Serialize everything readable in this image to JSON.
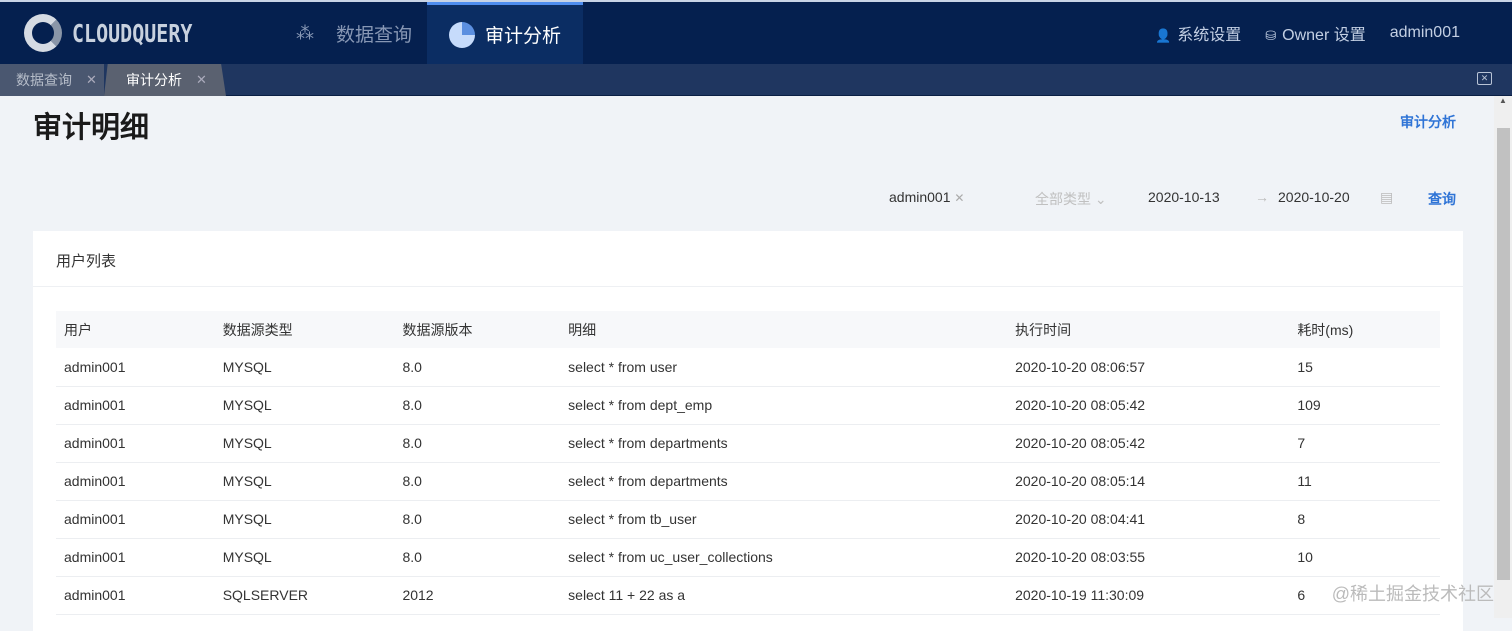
{
  "app": {
    "logo": "CLOUDQUERY",
    "nav": [
      {
        "label": "数据查询",
        "icon": "nodes-icon"
      },
      {
        "label": "审计分析",
        "icon": "pie-chart-icon",
        "active": true
      }
    ],
    "right": {
      "system_settings": "系统设置",
      "owner_settings": "Owner 设置",
      "user": "admin001"
    }
  },
  "tabs": [
    {
      "label": "数据查询"
    },
    {
      "label": "审计分析",
      "active": true
    }
  ],
  "page": {
    "title": "审计明细",
    "link": "审计分析"
  },
  "filters": {
    "user": "admin001",
    "type_placeholder": "全部类型",
    "start": "2020-10-13",
    "arrow": "→",
    "end": "2020-10-20",
    "query": "查询"
  },
  "card": {
    "title": "用户列表",
    "columns": [
      "用户",
      "数据源类型",
      "数据源版本",
      "明细",
      "执行时间",
      "耗时(ms)"
    ],
    "rows": [
      [
        "admin001",
        "MYSQL",
        "8.0",
        "select * from user",
        "2020-10-20 08:06:57",
        "15"
      ],
      [
        "admin001",
        "MYSQL",
        "8.0",
        "select * from dept_emp",
        "2020-10-20 08:05:42",
        "109"
      ],
      [
        "admin001",
        "MYSQL",
        "8.0",
        "select * from departments",
        "2020-10-20 08:05:42",
        "7"
      ],
      [
        "admin001",
        "MYSQL",
        "8.0",
        "select * from departments",
        "2020-10-20 08:05:14",
        "11"
      ],
      [
        "admin001",
        "MYSQL",
        "8.0",
        "select * from tb_user",
        "2020-10-20 08:04:41",
        "8"
      ],
      [
        "admin001",
        "MYSQL",
        "8.0",
        "select * from uc_user_collections",
        "2020-10-20 08:03:55",
        "10"
      ],
      [
        "admin001",
        "SQLSERVER",
        "2012",
        "select 11 + 22 as a",
        "2020-10-19 11:30:09",
        "6"
      ]
    ]
  },
  "watermark": "@稀土掘金技术社区"
}
